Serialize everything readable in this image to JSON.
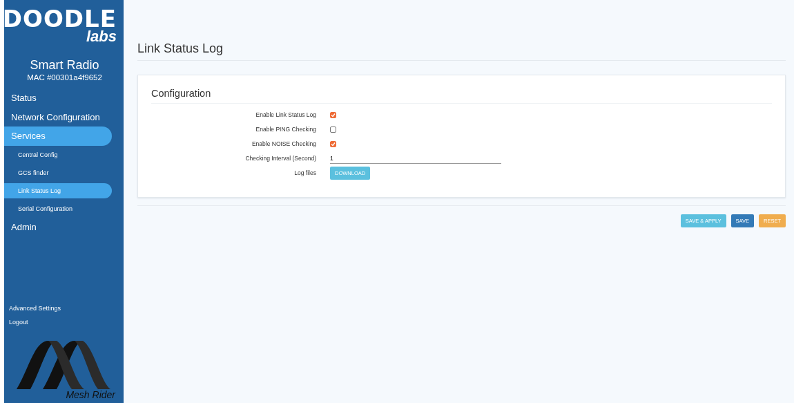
{
  "sidebar": {
    "logo": {
      "top": "DOODLE",
      "bottom": "labs"
    },
    "device_name": "Smart Radio",
    "mac": "MAC #00301a4f9652",
    "items": [
      {
        "label": "Status",
        "kind": "top",
        "selected": false
      },
      {
        "label": "Network Configuration",
        "kind": "top",
        "selected": false
      },
      {
        "label": "Services",
        "kind": "top",
        "selected": true
      },
      {
        "label": "Central Config",
        "kind": "sub",
        "selected": false
      },
      {
        "label": "GCS finder",
        "kind": "sub",
        "selected": false
      },
      {
        "label": "Link Status Log",
        "kind": "sub",
        "selected": true
      },
      {
        "label": "Serial Configuration",
        "kind": "sub",
        "selected": false
      },
      {
        "label": "Admin",
        "kind": "top",
        "selected": false
      }
    ],
    "footer_links": [
      "Advanced Settings",
      "Logout"
    ],
    "brand": "Mesh Rider"
  },
  "page_title": "Link Status Log",
  "section": {
    "title": "Configuration",
    "fields": [
      {
        "label": "Enable Link Status Log",
        "kind": "checkbox",
        "checked": true
      },
      {
        "label": "Enable PING Checking",
        "kind": "checkbox",
        "checked": false
      },
      {
        "label": "Enable NOISE Checking",
        "kind": "checkbox",
        "checked": true
      },
      {
        "label": "Checking Interval (Second)",
        "kind": "text",
        "value": "1"
      },
      {
        "label": "Log files",
        "kind": "button",
        "button": "DOWNLOAD"
      }
    ]
  },
  "actions": [
    {
      "label": "SAVE & APPLY",
      "kind": "info"
    },
    {
      "label": "SAVE",
      "kind": "primary"
    },
    {
      "label": "RESET",
      "kind": "warning"
    }
  ]
}
